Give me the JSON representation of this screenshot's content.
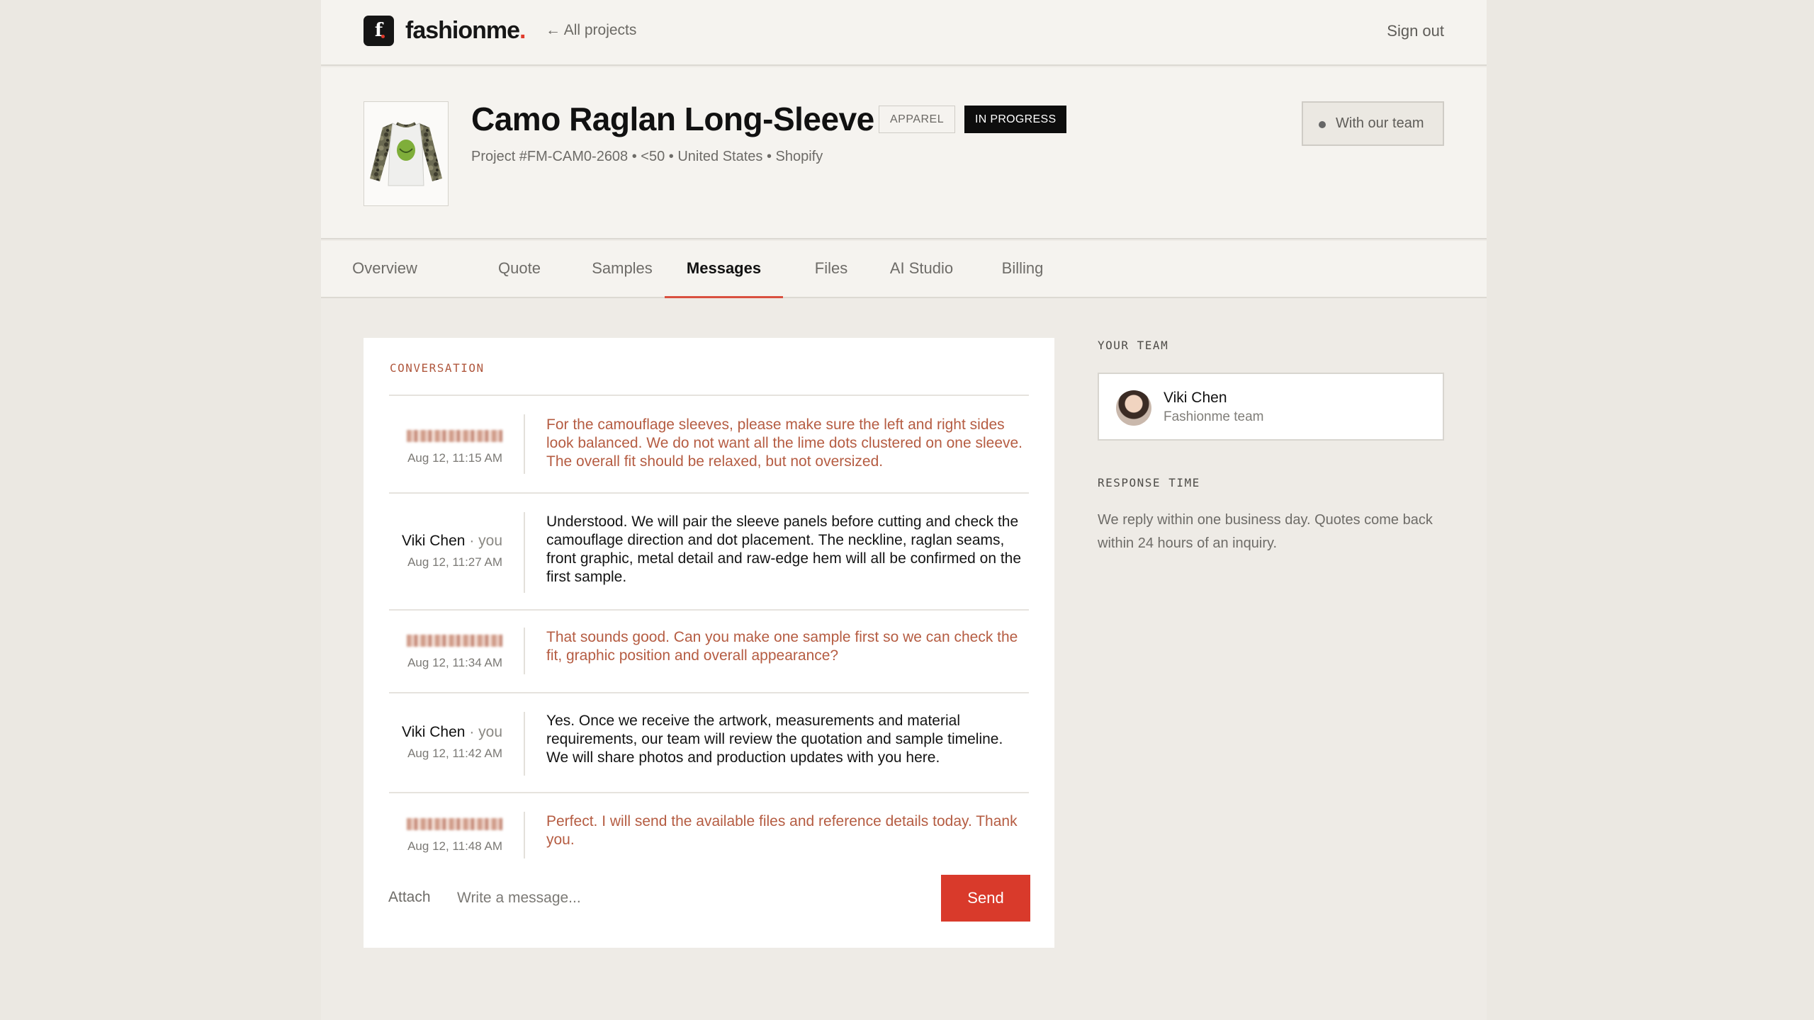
{
  "app": {
    "logo_mark": "f",
    "logo_name": "fashionme",
    "logo_period": "."
  },
  "nav": {
    "back_label": "All projects",
    "signout_label": "Sign out"
  },
  "project": {
    "title": "Camo Raglan Long-Sleeve",
    "category_badge": "APPAREL",
    "status_badge": "IN PROGRESS",
    "meta": "Project #FM-CAM0-2608 • <50 • United States • Shopify",
    "team_button": "With our team"
  },
  "tabs": [
    {
      "label": "Overview"
    },
    {
      "label": "Quote"
    },
    {
      "label": "Samples"
    },
    {
      "label": "Messages",
      "active": true
    },
    {
      "label": "Files"
    },
    {
      "label": "AI Studio"
    },
    {
      "label": "Billing"
    }
  ],
  "conversation": {
    "label": "CONVERSATION",
    "messages": [
      {
        "sender": "",
        "sender_type": "client",
        "time": "Aug 12, 11:15 AM",
        "text": "For the camouflage sleeves, please make sure the left and right sides look balanced. We do not want all the lime dots clustered on one sleeve. The overall fit should be relaxed, but not oversized."
      },
      {
        "sender": "Viki Chen",
        "you": "· you",
        "sender_type": "team",
        "time": "Aug 12, 11:27 AM",
        "text": "Understood. We will pair the sleeve panels before cutting and check the camouflage direction and dot placement. The neckline, raglan seams, front graphic, metal detail and raw-edge hem will all be confirmed on the first sample."
      },
      {
        "sender": "",
        "sender_type": "client",
        "time": "Aug 12, 11:34 AM",
        "text": "That sounds good. Can you make one sample first so we can check the fit, graphic position and overall appearance?"
      },
      {
        "sender": "Viki Chen",
        "you": "· you",
        "sender_type": "team",
        "time": "Aug 12, 11:42 AM",
        "text": "Yes. Once we receive the artwork, measurements and material requirements, our team will review the quotation and sample timeline. We will share photos and production updates with you here."
      },
      {
        "sender": "",
        "sender_type": "client",
        "time": "Aug 12, 11:48 AM",
        "text": "Perfect. I will send the available files and reference details today. Thank you."
      }
    ],
    "attach_label": "Attach",
    "input_placeholder": "Write a message...",
    "send_label": "Send"
  },
  "sidebar": {
    "team_label": "YOUR TEAM",
    "member_name": "Viki Chen",
    "member_role": "Fashionme team",
    "response_label": "RESPONSE TIME",
    "response_text": "We reply within one business day. Quotes come back within 24 hours of an inquiry."
  },
  "colors": {
    "accent": "#d93a2b",
    "client_text": "#b55c42",
    "status_badge_bg": "#0d0d0d"
  }
}
